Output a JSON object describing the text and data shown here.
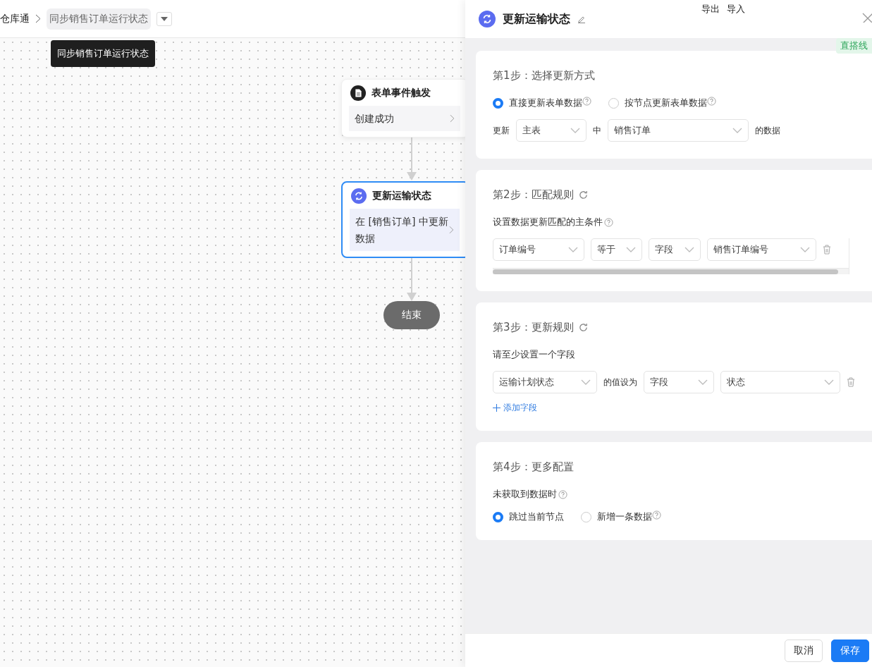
{
  "breadcrumb": {
    "app": "仓库通",
    "flow": "同步销售订单运行状态"
  },
  "tooltip": "同步销售订单运行状态",
  "flow_nodes": [
    {
      "kind": "trigger",
      "title": "表单事件触发",
      "body": "创建成功",
      "selected": false
    },
    {
      "kind": "action",
      "title": "更新运输状态",
      "body": "在 [销售订单] 中更新数据",
      "selected": true
    },
    {
      "kind": "end",
      "title": "结束"
    }
  ],
  "panel": {
    "title": "更新运输状态",
    "header_links": [
      "导出",
      "导入"
    ],
    "badge": "直搭线",
    "steps": [
      {
        "title": "第1步：选择更新方式",
        "refresh": false,
        "blocks": [
          {
            "kind": "radios",
            "options": [
              {
                "label": "直接更新表单数据",
                "help": true,
                "selected": true
              },
              {
                "label": "按节点更新表单数据",
                "help": true,
                "selected": false
              }
            ]
          },
          {
            "kind": "row",
            "items": [
              {
                "kind": "text",
                "text": "更新"
              },
              {
                "kind": "select",
                "value": "主表"
              },
              {
                "kind": "text",
                "text": "中"
              },
              {
                "kind": "select",
                "value": "销售订单"
              },
              {
                "kind": "text",
                "text": "的数据"
              }
            ]
          }
        ]
      },
      {
        "title": "第2步：匹配规则",
        "refresh": true,
        "blocks": [
          {
            "kind": "label",
            "text": "设置数据更新匹配的主条件",
            "help": true
          },
          {
            "kind": "scroll_row",
            "items": [
              {
                "kind": "select",
                "value": "订单编号"
              },
              {
                "kind": "select",
                "value": "等于"
              },
              {
                "kind": "select",
                "value": "字段"
              },
              {
                "kind": "select",
                "value": "销售订单编号"
              },
              {
                "kind": "delete"
              }
            ]
          }
        ]
      },
      {
        "title": "第3步：更新规则",
        "refresh": true,
        "blocks": [
          {
            "kind": "label",
            "text": "请至少设置一个字段",
            "help": false
          },
          {
            "kind": "row",
            "items": [
              {
                "kind": "select",
                "value": "运输计划状态"
              },
              {
                "kind": "text",
                "text": "的值设为"
              },
              {
                "kind": "select",
                "value": "字段"
              },
              {
                "kind": "select",
                "value": "状态"
              },
              {
                "kind": "delete"
              }
            ]
          },
          {
            "kind": "link",
            "text": "添加字段"
          }
        ]
      },
      {
        "title": "第4步：更多配置",
        "refresh": false,
        "blocks": [
          {
            "kind": "label",
            "text": "未获取到数据时",
            "help": true
          },
          {
            "kind": "radios",
            "options": [
              {
                "label": "跳过当前节点",
                "help": false,
                "selected": true
              },
              {
                "label": "新增一条数据",
                "help": true,
                "selected": false
              }
            ]
          }
        ]
      }
    ]
  },
  "footer_buttons": [
    {
      "label": "取消",
      "kind": "default"
    },
    {
      "label": "保存",
      "kind": "primary"
    }
  ]
}
